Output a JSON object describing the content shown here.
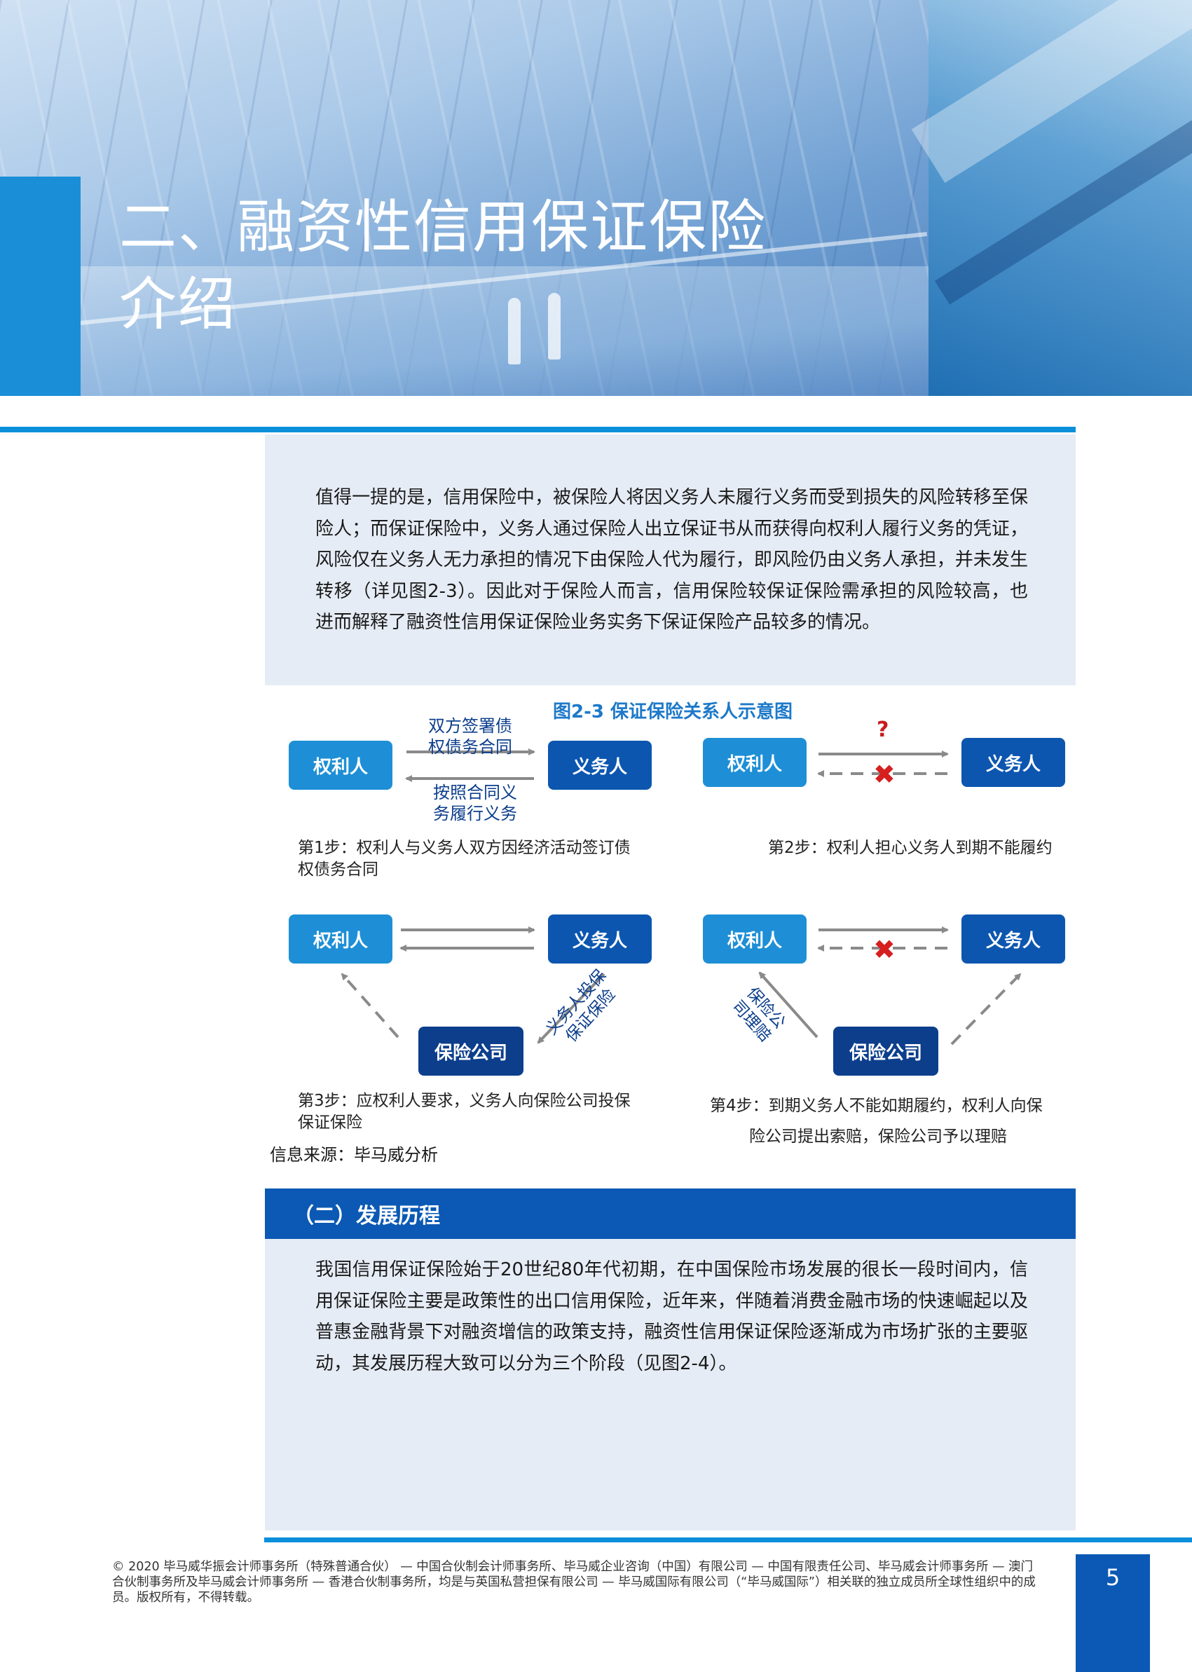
{
  "section": {
    "title_line1": "二、融资性信用保证保险",
    "title_line2": "介绍"
  },
  "intro_paragraph": "值得一提的是，信用保险中，被保险人将因义务人未履行义务而受到损失的风险转移至保险人；而保证保险中，义务人通过保险人出立保证书从而获得向权利人履行义务的凭证，风险仅在义务人无力承担的情况下由保险人代为履行，即风险仍由义务人承担，并未发生转移（详见图2-3）。因此对于保险人而言，信用保险较保证保险需承担的风险较高，也进而解释了融资性信用保证保险业务实务下保证保险产品较多的情况。",
  "figure": {
    "title": "图2-3 保证保险关系人示意图",
    "step1": {
      "creditor": "权利人",
      "debtor": "义务人",
      "top_label_1": "双方签署债",
      "top_label_2": "权债务合同",
      "bottom_label_1": "按照合同义",
      "bottom_label_2": "务履行义务",
      "caption_1": "第1步：权利人与义务人双方因经济活动签订债",
      "caption_2": "权债务合同"
    },
    "step2": {
      "creditor": "权利人",
      "debtor": "义务人",
      "question": "?",
      "cross": "✖",
      "caption": "第2步：权利人担心义务人到期不能履约"
    },
    "step3": {
      "creditor": "权利人",
      "debtor": "义务人",
      "insurer": "保险公司",
      "diag_label_1": "义务人投保",
      "diag_label_2": "保证保险",
      "caption_1": "第3步：应权利人要求，义务人向保险公司投保",
      "caption_2": "保证保险"
    },
    "step4": {
      "creditor": "权利人",
      "debtor": "义务人",
      "insurer": "保险公司",
      "cross": "✖",
      "diag_label_1": "保险公",
      "diag_label_2": "司理赔",
      "caption_1": "第4步：到期义务人不能如期履约，权利人向保",
      "caption_2": "险公司提出索赔，保险公司予以理赔"
    },
    "source": "信息来源：毕马威分析"
  },
  "history": {
    "heading": "（二）发展历程",
    "paragraph": "我国信用保证保险始于20世纪80年代初期，在中国保险市场发展的很长一段时间内，信用保证保险主要是政策性的出口信用保险，近年来，伴随着消费金融市场的快速崛起以及普惠金融背景下对融资增信的政策支持，融资性信用保证保险逐渐成为市场扩张的主要驱动，其发展历程大致可以分为三个阶段（见图2-4）。"
  },
  "footer": {
    "copyright": "© 2020 毕马威华振会计师事务所（特殊普通合伙） — 中国合伙制会计师事务所、毕马威企业咨询（中国）有限公司 — 中国有限责任公司、毕马威会计师事务所 — 澳门合伙制事务所及毕马威会计师事务所 — 香港合伙制事务所，均是与英国私营担保有限公司 — 毕马威国际有限公司（“毕马威国际”）相关联的独立成员所全球性组织中的成员。版权所有，不得转载。",
    "page_number": "5"
  },
  "colors": {
    "accent_blue": "#0a8fdb",
    "dark_blue": "#0b59b4",
    "navy": "#0c3e8c",
    "panel_bg": "#e6ecf5",
    "cross_red": "#d61f1f"
  }
}
